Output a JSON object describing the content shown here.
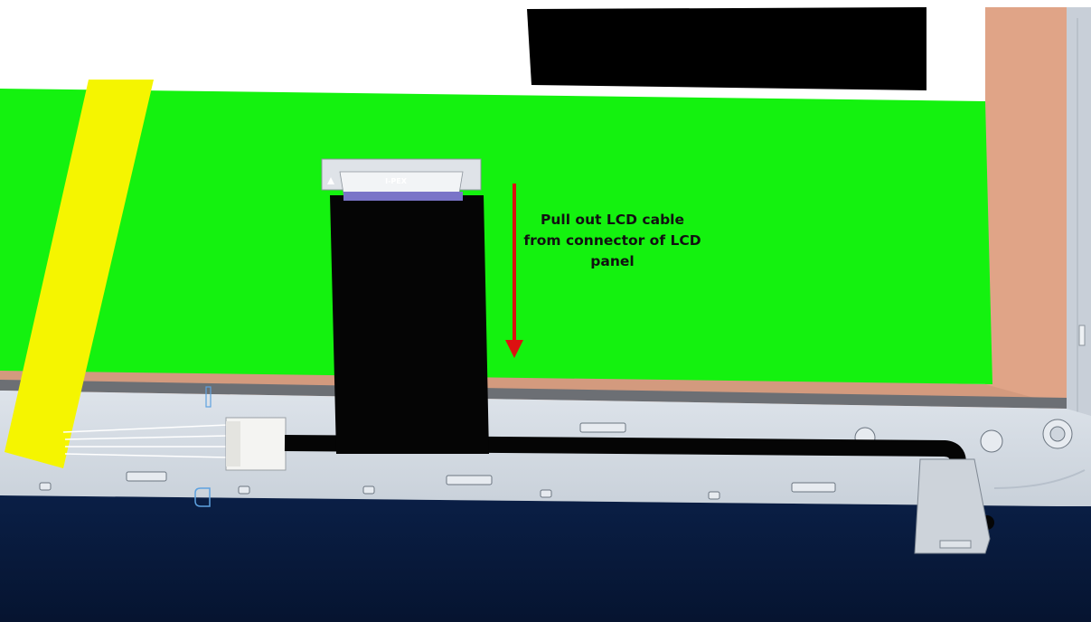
{
  "annotation": {
    "text": "Pull out LCD cable from connector of LCD panel"
  },
  "connector_label": "I-PEX",
  "colors": {
    "lcd_panel": "#14f20f",
    "panel_border": "#e0a487",
    "bezel": "#d4dbe3",
    "bottom_area": "#0a1c40",
    "cable": "#050505",
    "tape": "#f5f500",
    "arrow": "#dd1111",
    "label_block": "#000000"
  }
}
